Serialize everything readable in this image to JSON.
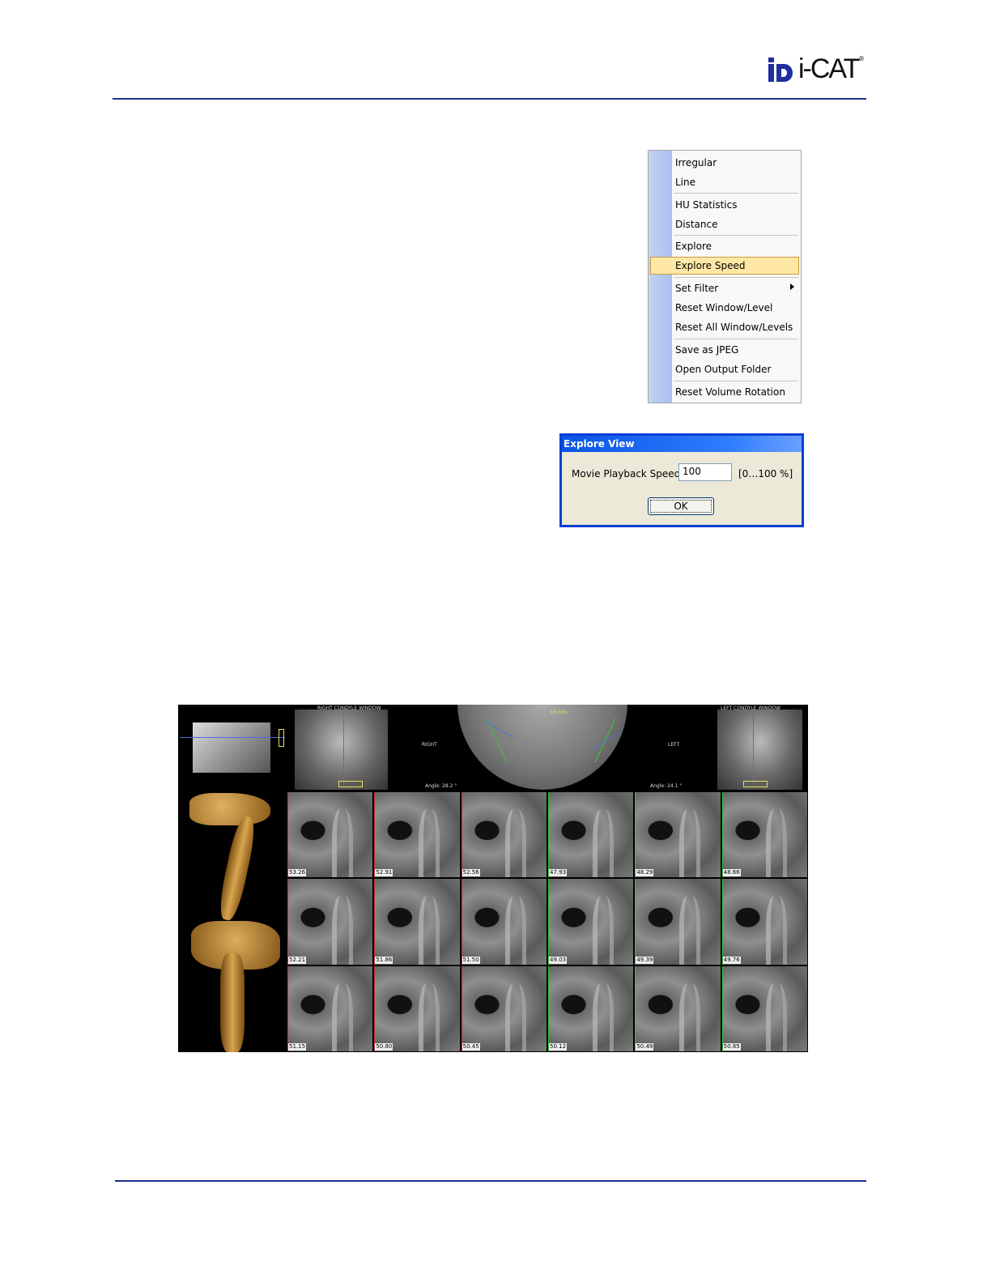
{
  "logo": {
    "word": "i-CAT",
    "reg": "®"
  },
  "context_menu": {
    "items": [
      {
        "label": "Irregular"
      },
      {
        "label": "Line"
      },
      {
        "label": "HU Statistics"
      },
      {
        "label": "Distance"
      },
      {
        "label": "Explore"
      },
      {
        "label": "Explore Speed"
      },
      {
        "label": "Set Filter"
      },
      {
        "label": "Reset Window/Level"
      },
      {
        "label": "Reset All Window/Levels"
      },
      {
        "label": "Save as JPEG"
      },
      {
        "label": "Open Output Folder"
      },
      {
        "label": "Reset Volume Rotation"
      }
    ],
    "highlighted": "Explore Speed"
  },
  "dialog": {
    "title": "Explore View",
    "label": "Movie Playback Speed:",
    "value": "100",
    "range": "[0…100 %]",
    "ok": "OK"
  },
  "ct_panel": {
    "right_condyle": "RIGHT CONDYLE WINDOW",
    "left_condyle": "LEFT CONDYLE WINDOW",
    "right": "RIGHT",
    "left": "LEFT",
    "angle_left": "Angle: 28.2 °",
    "angle_right": "Angle: 24.1 °",
    "scale": "10 mm",
    "slices": [
      [
        "53.26",
        "52.91",
        "52.56",
        "47.93",
        "48.29",
        "48.66"
      ],
      [
        "52.21",
        "51.86",
        "51.50",
        "49.03",
        "49.39",
        "49.76"
      ],
      [
        "51.15",
        "50.80",
        "50.45",
        "50.12",
        "50.49",
        "50.85"
      ]
    ]
  }
}
